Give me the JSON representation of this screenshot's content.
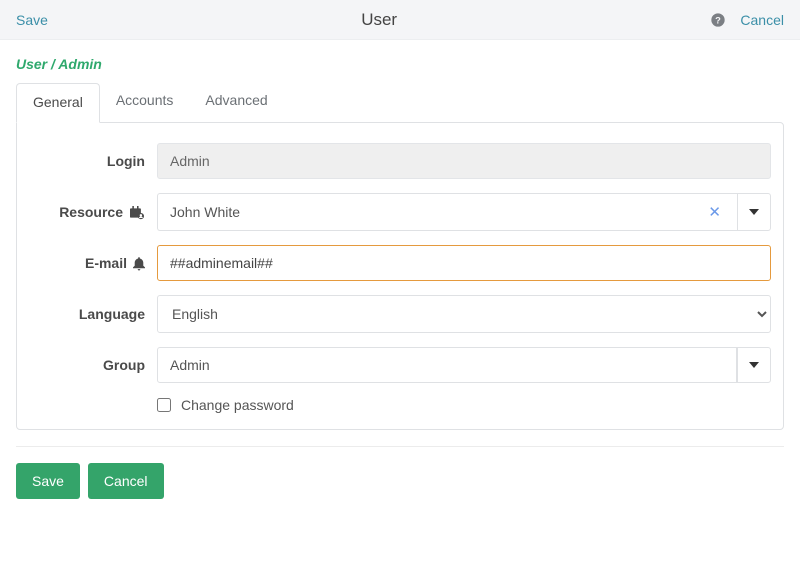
{
  "header": {
    "save_link": "Save",
    "title": "User",
    "cancel_link": "Cancel"
  },
  "breadcrumb": "User / Admin",
  "tabs": [
    {
      "label": "General",
      "active": true
    },
    {
      "label": "Accounts",
      "active": false
    },
    {
      "label": "Advanced",
      "active": false
    }
  ],
  "form": {
    "login": {
      "label": "Login",
      "value": "Admin"
    },
    "resource": {
      "label": "Resource",
      "value": "John White"
    },
    "email": {
      "label": "E-mail",
      "value": "##adminemail##"
    },
    "language": {
      "label": "Language",
      "value": "English"
    },
    "group": {
      "label": "Group",
      "value": "Admin"
    },
    "change_password_label": "Change password"
  },
  "footer": {
    "save": "Save",
    "cancel": "Cancel"
  }
}
